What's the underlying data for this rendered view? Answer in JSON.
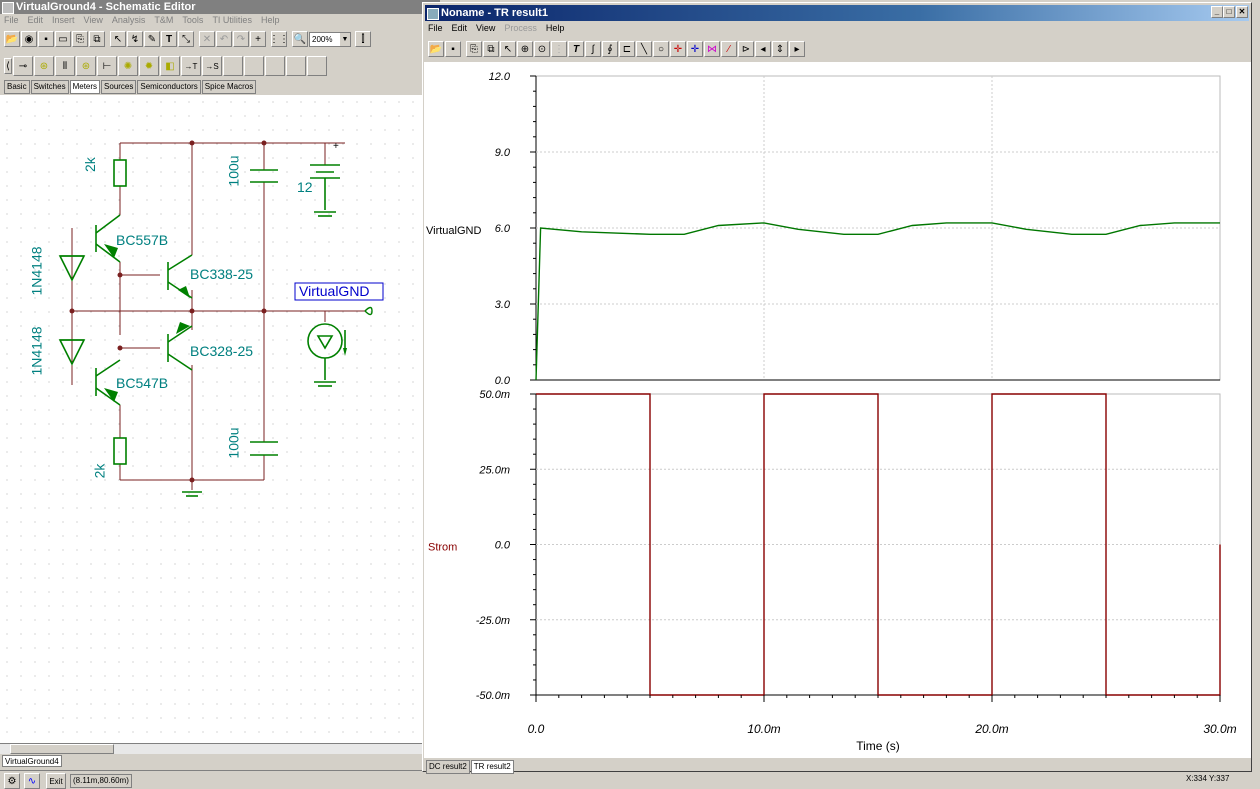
{
  "schematic": {
    "title": "VirtualGround4 - Schematic Editor",
    "menu": [
      "File",
      "Edit",
      "Insert",
      "View",
      "Analysis",
      "T&M",
      "Tools",
      "TI Utilities",
      "Help"
    ],
    "zoom": "200%",
    "tabs": [
      "Basic",
      "Switches",
      "Meters",
      "Sources",
      "Semiconductors",
      "Spice Macros"
    ],
    "active_tab": "Meters",
    "components": {
      "r_top": "2k",
      "r_bottom": "2k",
      "q1": "BC557B",
      "q2": "BC338-25",
      "q3": "BC328-25",
      "q4": "BC547B",
      "d1": "1N4148",
      "d2": "1N4148",
      "c1": "100u",
      "c2": "100u",
      "battery": "12",
      "plus": "+",
      "output_label": "VirtualGND"
    },
    "doc_tab": "VirtualGround4",
    "exit_label": "Exit",
    "coords": "(8.11m,80.60m)"
  },
  "result": {
    "title": "Noname - TR result1",
    "menu": [
      "File",
      "Edit",
      "View",
      "Process",
      "Help"
    ],
    "tabs": [
      "DC result2",
      "TR result2"
    ],
    "active_tab": "TR result2",
    "status_xy": "X:334  Y:337"
  },
  "chart_data": [
    {
      "type": "line",
      "ylabel": "VirtualGND",
      "ylim": [
        0.0,
        12.0
      ],
      "yticks": [
        "12.0",
        "9.0",
        "6.0",
        "3.0",
        "0.0"
      ],
      "x": [
        0,
        0.0002,
        0.002,
        0.005,
        0.0065,
        0.008,
        0.01,
        0.0115,
        0.0135,
        0.015,
        0.0165,
        0.018,
        0.02,
        0.0215,
        0.0235,
        0.025,
        0.0265,
        0.028,
        0.03
      ],
      "series": [
        {
          "color": "#007700",
          "values": [
            0,
            6.0,
            5.85,
            5.75,
            5.75,
            6.1,
            6.2,
            5.95,
            5.75,
            5.75,
            6.1,
            6.2,
            6.2,
            5.95,
            5.75,
            5.75,
            6.1,
            6.2,
            6.2
          ]
        }
      ]
    },
    {
      "type": "line",
      "ylabel": "Strom",
      "xlabel": "Time (s)",
      "ylim": [
        -50.0,
        50.0
      ],
      "yticks": [
        "50.0m",
        "25.0m",
        "0.0",
        "-25.0m",
        "-50.0m"
      ],
      "xlim": [
        0,
        30.0
      ],
      "xticks": [
        "0.0",
        "10.0m",
        "20.0m",
        "30.0m"
      ],
      "x": [
        0,
        5,
        5,
        10,
        10,
        15,
        15,
        20,
        20,
        25,
        25,
        30,
        30
      ],
      "series": [
        {
          "color": "#880000",
          "values": [
            50,
            50,
            -50,
            -50,
            50,
            50,
            -50,
            -50,
            50,
            50,
            -50,
            -50,
            0
          ]
        }
      ]
    }
  ]
}
